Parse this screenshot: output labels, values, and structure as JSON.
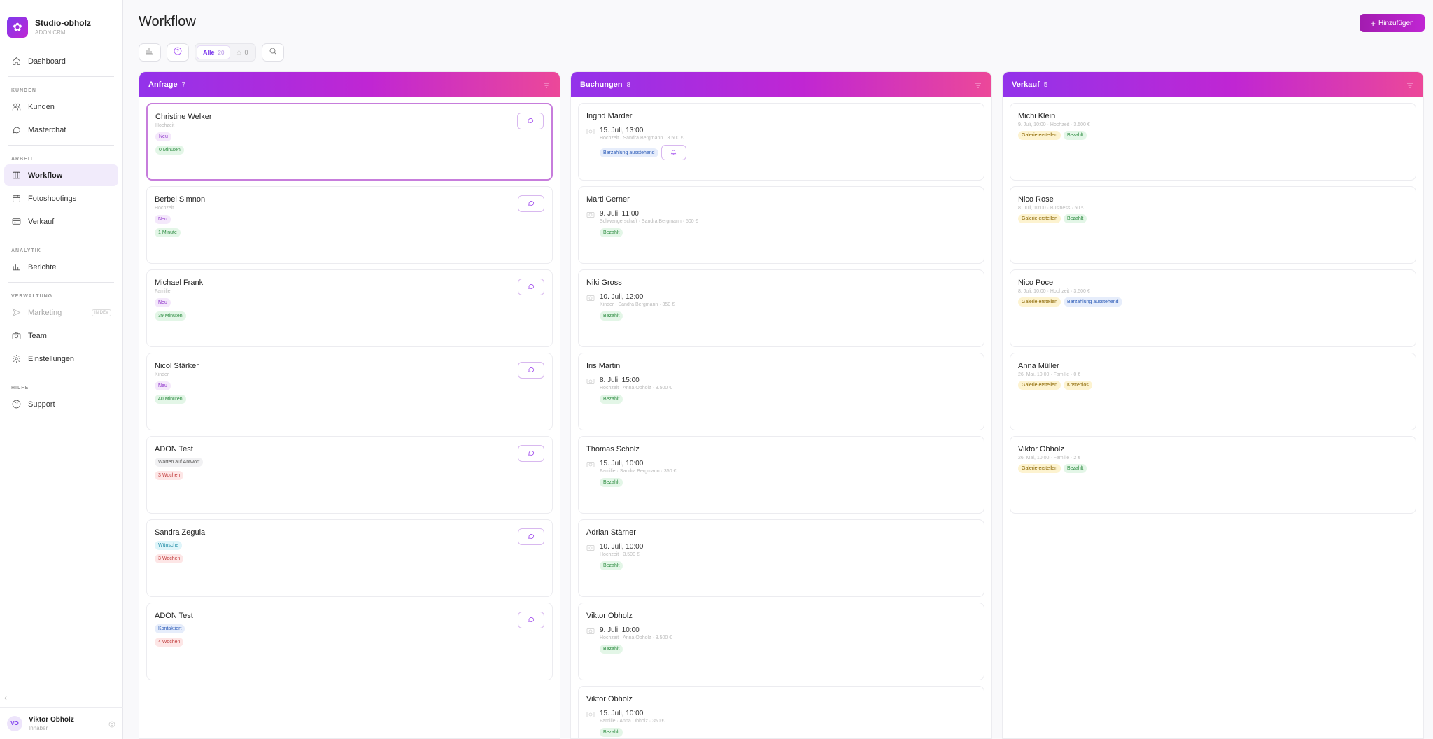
{
  "brand": {
    "name": "Studio-obholz",
    "sub": "ADON CRM"
  },
  "nav": {
    "dashboard": "Dashboard",
    "section_kunden": "KUNDEN",
    "kunden": "Kunden",
    "masterchat": "Masterchat",
    "section_arbeit": "ARBEIT",
    "workflow": "Workflow",
    "fotoshootings": "Fotoshootings",
    "verkauf": "Verkauf",
    "section_analytik": "ANALYTIK",
    "berichte": "Berichte",
    "section_verwaltung": "VERWALTUNG",
    "marketing": "Marketing",
    "marketing_badge": "IN DEV",
    "team": "Team",
    "einstellungen": "Einstellungen",
    "section_hilfe": "HILFE",
    "support": "Support"
  },
  "user": {
    "initials": "VO",
    "name": "Viktor Obholz",
    "role": "Inhaber"
  },
  "header": {
    "title": "Workflow",
    "add_label": "Hinzufügen"
  },
  "toolbar": {
    "all_label": "Alle",
    "all_count": "20",
    "warn_count": "0"
  },
  "columns": [
    {
      "title": "Anfrage",
      "count": "7",
      "cards": [
        {
          "name": "Christine Welker",
          "type": "Hochzeit",
          "status": "Neu",
          "time": "0 Minuten"
        },
        {
          "name": "Berbel Simnon",
          "type": "Hochzeit",
          "status": "Neu",
          "time": "1 Minute"
        },
        {
          "name": "Michael Frank",
          "type": "Familie",
          "status": "Neu",
          "time": "39 Minuten"
        },
        {
          "name": "Nicol Stärker",
          "type": "Kinder",
          "status": "Neu",
          "time": "40 Minuten"
        },
        {
          "name": "ADON Test",
          "status": "Warten auf Antwort",
          "time": "3 Wochen"
        },
        {
          "name": "Sandra Zegula",
          "status": "Wünsche",
          "time": "3 Wochen"
        },
        {
          "name": "ADON Test",
          "status": "Kontaktiert",
          "time": "4 Wochen"
        }
      ]
    },
    {
      "title": "Buchungen",
      "count": "8",
      "cards": [
        {
          "name": "Ingrid Marder",
          "date": "15. Juli, 13:00",
          "meta": "Hochzeit · Sandra Bergmann · 3.500 €",
          "badge": "Barzahlung ausstehend"
        },
        {
          "name": "Marti Gerner",
          "date": "9. Juli, 11:00",
          "meta": "Schwangerschaft · Sandra Bergmann · 500 €",
          "badge": "Bezahlt"
        },
        {
          "name": "Niki Gross",
          "date": "10. Juli, 12:00",
          "meta": "Kinder · Sandra Bergmann · 350 €",
          "badge": "Bezahlt"
        },
        {
          "name": "Iris Martin",
          "date": "8. Juli, 15:00",
          "meta": "Hochzeit · Anna Obholz · 3.500 €",
          "badge": "Bezahlt"
        },
        {
          "name": "Thomas Scholz",
          "date": "15. Juli, 10:00",
          "meta": "Familie · Sandra Bergmann · 350 €",
          "badge": "Bezahlt"
        },
        {
          "name": "Adrian Stärner",
          "date": "10. Juli, 10:00",
          "meta": "Hochzeit · 3.500 €",
          "badge": "Bezahlt"
        },
        {
          "name": "Viktor Obholz",
          "date": "9. Juli, 10:00",
          "meta": "Hochzeit · Anna Obholz · 3.500 €",
          "badge": "Bezahlt"
        },
        {
          "name": "Viktor Obholz",
          "date": "15. Juli, 10:00",
          "meta": "Familie · Anna Obholz · 350 €",
          "badge": "Bezahlt"
        }
      ]
    },
    {
      "title": "Verkauf",
      "count": "5",
      "cards": [
        {
          "name": "Michi Klein",
          "meta": "9. Juli, 10:00 · Hochzeit · 3.500 €",
          "badge1": "Galerie erstellen",
          "badge2": "Bezahlt"
        },
        {
          "name": "Nico Rose",
          "meta": "8. Juli, 10:00 · Business · 50 €",
          "badge1": "Galerie erstellen",
          "badge2": "Bezahlt"
        },
        {
          "name": "Nico Poce",
          "meta": "8. Juli, 10:00 · Hochzeit · 3.500 €",
          "badge1": "Galerie erstellen",
          "badge2": "Barzahlung ausstehend"
        },
        {
          "name": "Anna Müller",
          "meta": "26. Mai, 10:00 · Familie · 0 €",
          "badge1": "Galerie erstellen",
          "badge2": "Kostenlos"
        },
        {
          "name": "Viktor Obholz",
          "meta": "26. Mai, 10:00 · Familie · 2 €",
          "badge1": "Galerie erstellen",
          "badge2": "Bezahlt"
        }
      ]
    }
  ]
}
